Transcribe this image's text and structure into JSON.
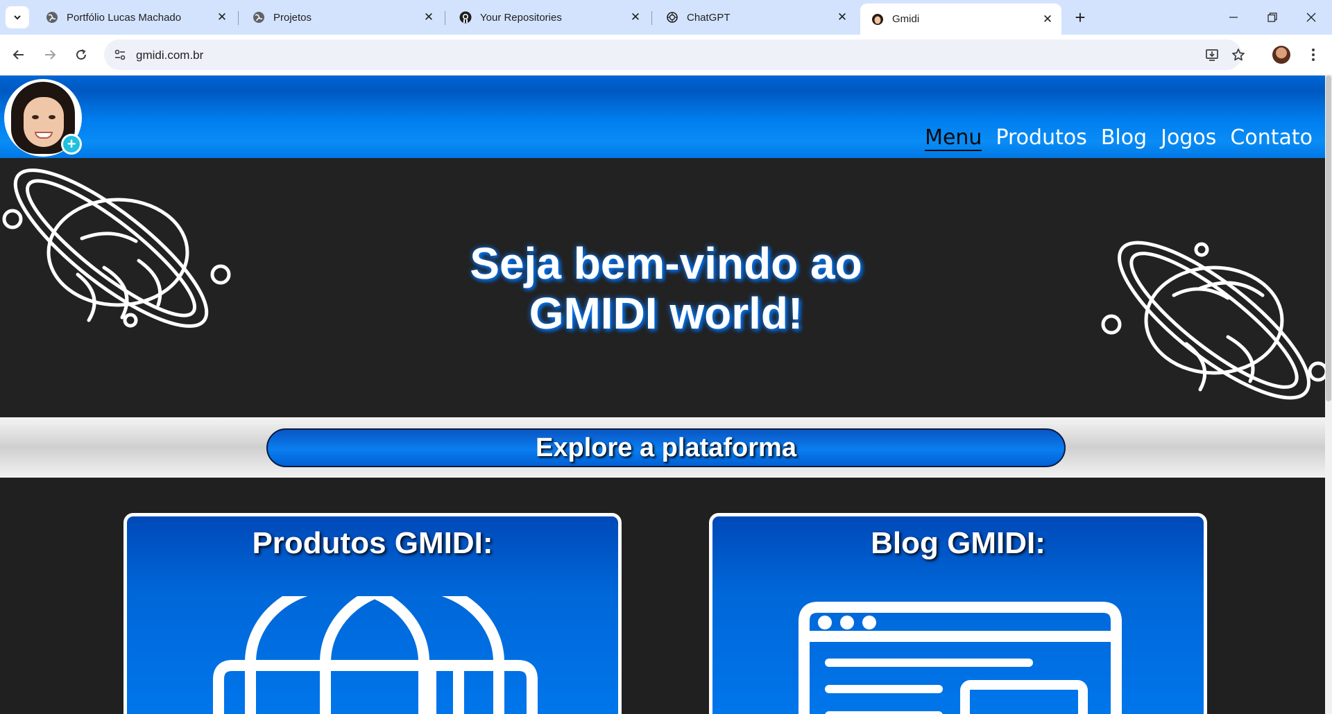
{
  "browser": {
    "tabs": [
      {
        "title": "Portfólio Lucas Machado",
        "icon": "globe-icon",
        "active": false
      },
      {
        "title": "Projetos",
        "icon": "globe-icon",
        "active": false
      },
      {
        "title": "Your Repositories",
        "icon": "github-icon",
        "active": false
      },
      {
        "title": "ChatGPT",
        "icon": "chatgpt-icon",
        "active": false
      },
      {
        "title": "Gmidi",
        "icon": "avatar-favicon-icon",
        "active": true
      }
    ],
    "close_glyph": "✕",
    "new_tab_glyph": "+",
    "url": "gmidi.com.br"
  },
  "site": {
    "nav": [
      {
        "label": "Menu",
        "active": true
      },
      {
        "label": "Produtos",
        "active": false
      },
      {
        "label": "Blog",
        "active": false
      },
      {
        "label": "Jogos",
        "active": false
      },
      {
        "label": "Contato",
        "active": false
      }
    ],
    "logo_badge": "+",
    "hero_title_line1": "Seja bem-vindo ao",
    "hero_title_line2": "GMIDI world!",
    "explore_label": "Explore a plataforma",
    "cards": [
      {
        "title": "Produtos GMIDI:",
        "icon": "shop-icon"
      },
      {
        "title": "Blog GMIDI:",
        "icon": "blog-window-icon"
      }
    ]
  },
  "colors": {
    "header_blue": "#007ff0",
    "hero_bg": "#222222",
    "tabstrip": "#d3e3fd",
    "card_blue": "#0067d8"
  }
}
